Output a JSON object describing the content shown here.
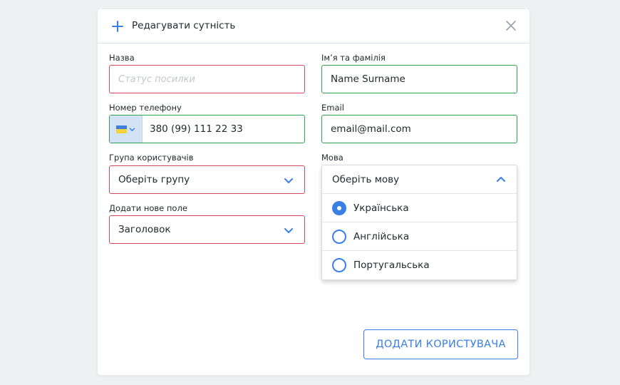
{
  "modal": {
    "title": "Редагувати сутність",
    "header_icon": "plus-icon",
    "close_icon": "close-icon"
  },
  "fields": {
    "name": {
      "label": "Назва",
      "value": "",
      "placeholder": "Статус посилки",
      "state": "invalid"
    },
    "full_name": {
      "label": "Ім’я та фамілія",
      "value": "Name Surname",
      "state": "valid"
    },
    "phone": {
      "label": "Номер телефону",
      "value": "380 (99) 111 22 33",
      "country_flag": "ukraine-flag-icon",
      "state": "valid"
    },
    "email": {
      "label": "Email",
      "value": "email@mail.com",
      "state": "valid"
    },
    "user_group": {
      "label": "Група користувачів",
      "value": "Оберіть групу",
      "state": "invalid"
    },
    "new_field": {
      "label": "Додати нове поле",
      "value": "Заголовок",
      "state": "invalid"
    },
    "language": {
      "label": "Мова",
      "value": "Оберіть мову",
      "expanded": true,
      "options": [
        {
          "label": "Українська",
          "checked": true
        },
        {
          "label": "Англійська",
          "checked": false
        },
        {
          "label": "Португальська",
          "checked": false
        }
      ]
    }
  },
  "actions": {
    "submit_label": "ДОДАТИ КОРИСТУВАЧА"
  },
  "colors": {
    "accent": "#3a7fe6",
    "valid_border": "#2fa44f",
    "invalid_border": "#d9455f",
    "flag_blue": "#3f7fde",
    "flag_yellow": "#f4d43b"
  }
}
